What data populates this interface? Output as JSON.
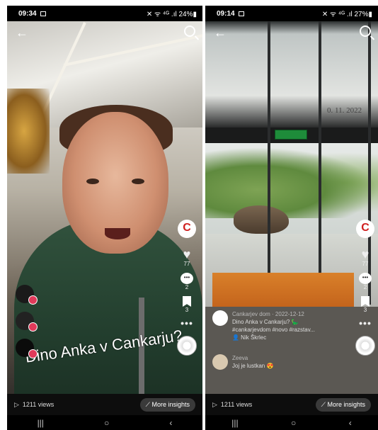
{
  "phoneA": {
    "status": {
      "time": "09:34",
      "right": "✕ ᯤ ⁴ᴳ .ıl 24%▮"
    },
    "caption": "Dino Anka v Cankarju?",
    "likes": "77",
    "comments": "2",
    "saves": "3",
    "views": "1211 views",
    "insights": "More insights"
  },
  "phoneB": {
    "status": {
      "time": "09:14",
      "right": "✕ ᯤ ⁴ᴳ .ıl 27%▮"
    },
    "sign": "0. 11. 2022",
    "post": {
      "author": "Cankarjev dom",
      "date": "2022-12-12",
      "title": "Dino Anka v Cankarju? 🦕",
      "tags": "#cankarjevdom #novo #razstav...",
      "credit": "👤 Nik Škrlec"
    },
    "comment": {
      "user": "Zeeva",
      "text": "Joj je lustkan 😍"
    },
    "likes": "77",
    "comments": "2",
    "saves": "3",
    "views": "1211 views",
    "insights": "More insights"
  },
  "nav": {
    "recent": "|||",
    "home": "○",
    "back": "‹"
  }
}
